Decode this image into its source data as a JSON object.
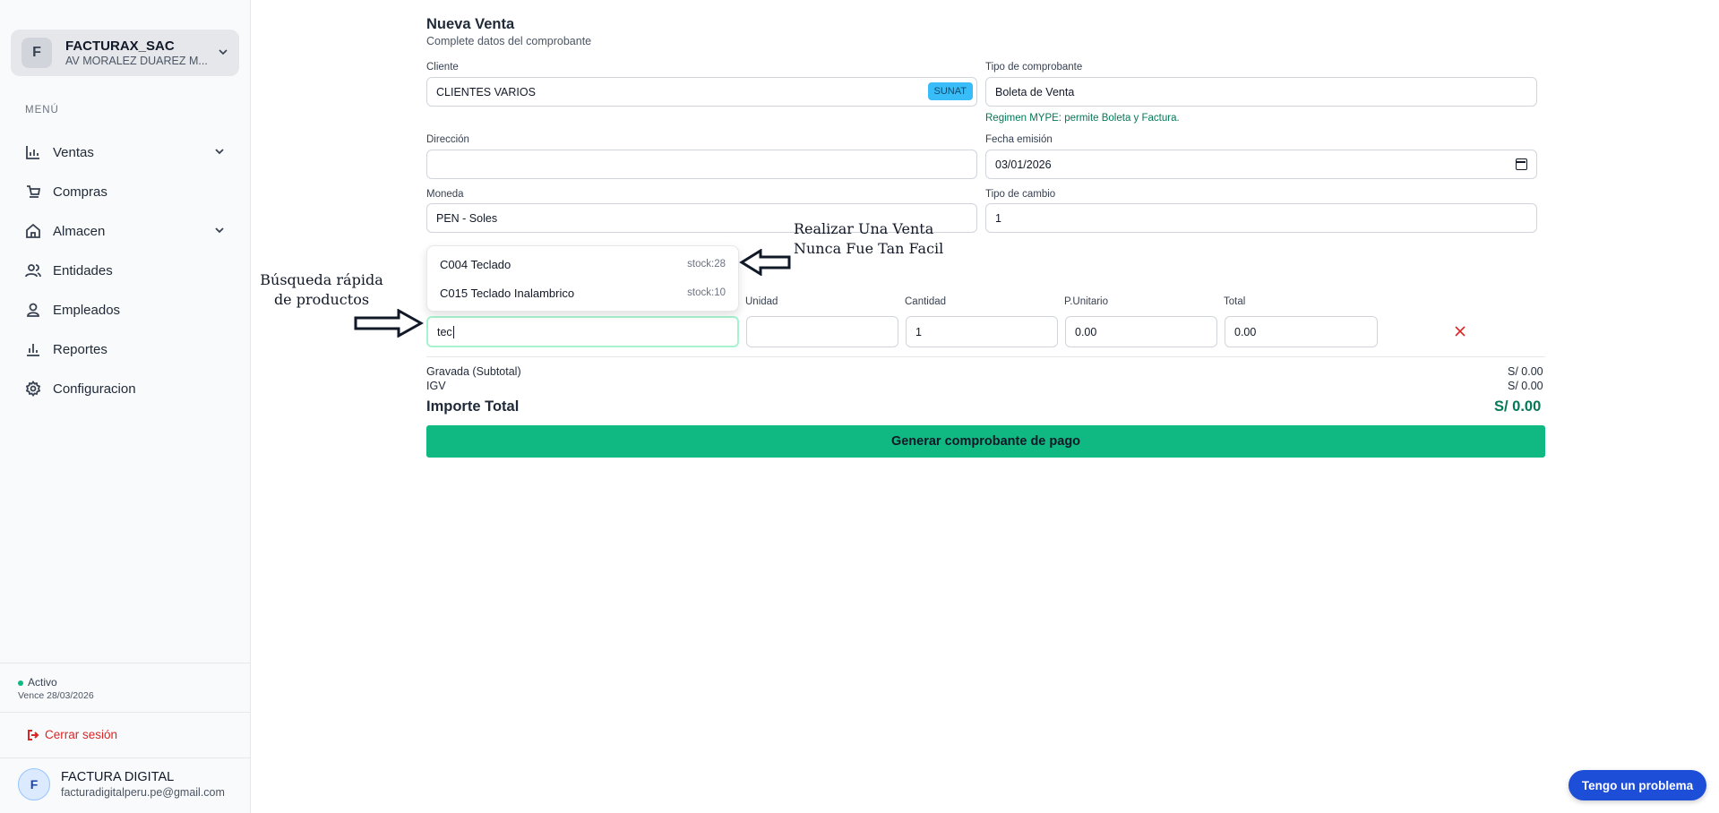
{
  "company": {
    "initial": "F",
    "name": "FACTURAX_SAC",
    "address": "AV MORALEZ DUAREZ M..."
  },
  "sidebar": {
    "menu_title": "MENÚ",
    "items": [
      {
        "label": "Ventas",
        "icon": "chart-bar-icon",
        "expandable": true
      },
      {
        "label": "Compras",
        "icon": "cart-icon",
        "expandable": false
      },
      {
        "label": "Almacen",
        "icon": "home-icon",
        "expandable": true
      },
      {
        "label": "Entidades",
        "icon": "users-icon",
        "expandable": false
      },
      {
        "label": "Empleados",
        "icon": "user-icon",
        "expandable": false
      },
      {
        "label": "Reportes",
        "icon": "bar-chart-icon",
        "expandable": false
      },
      {
        "label": "Configuracion",
        "icon": "gear-icon",
        "expandable": false
      }
    ],
    "status": "Activo",
    "expires": "Vence 28/03/2026",
    "logout": "Cerrar sesión"
  },
  "user": {
    "initial": "F",
    "name": "FACTURA DIGITAL",
    "email": "facturadigitalperu.pe@gmail.com"
  },
  "form": {
    "title": "Nueva Venta",
    "subtitle": "Complete datos del comprobante",
    "cliente_label": "Cliente",
    "cliente_value": "CLIENTES VARIOS",
    "sunat_label": "SUNAT",
    "tipo_label": "Tipo de comprobante",
    "tipo_value": "Boleta de Venta",
    "regimen_hint": "Regimen MYPE: permite Boleta y Factura.",
    "direccion_label": "Dirección",
    "direccion_value": "",
    "fecha_label": "Fecha emisión",
    "fecha_value": "03/01/2026",
    "moneda_label": "Moneda",
    "moneda_value": "PEN - Soles",
    "cambio_label": "Tipo de cambio",
    "cambio_value": "1"
  },
  "dropdown": [
    {
      "name": "C004 Teclado",
      "stock": "stock:28"
    },
    {
      "name": "C015 Teclado Inalambrico",
      "stock": "stock:10"
    }
  ],
  "item_row": {
    "unidad_label": "Unidad",
    "cantidad_label": "Cantidad",
    "punit_label": "P.Unitario",
    "total_label": "Total",
    "search_value": "tec",
    "unidad_value": "",
    "cantidad_value": "1",
    "punit_value": "0.00",
    "total_value": "0.00"
  },
  "totals": {
    "gravada_label": "Gravada (Subtotal)",
    "gravada_value": "S/ 0.00",
    "igv_label": "IGV",
    "igv_value": "S/ 0.00",
    "importe_label": "Importe Total",
    "importe_value": "S/ 0.00"
  },
  "generate_button": "Generar comprobante de pago",
  "annotations": {
    "left_line1": "Búsqueda rápida",
    "left_line2": "de productos",
    "right_line1": "Realizar Una Venta",
    "right_line2": "Nunca Fue Tan Facil"
  },
  "help_button": "Tengo un problema",
  "colors": {
    "accent": "#10b981",
    "help": "#1d4ed8",
    "danger": "#dc2626",
    "sunat": "#38bdf8"
  }
}
